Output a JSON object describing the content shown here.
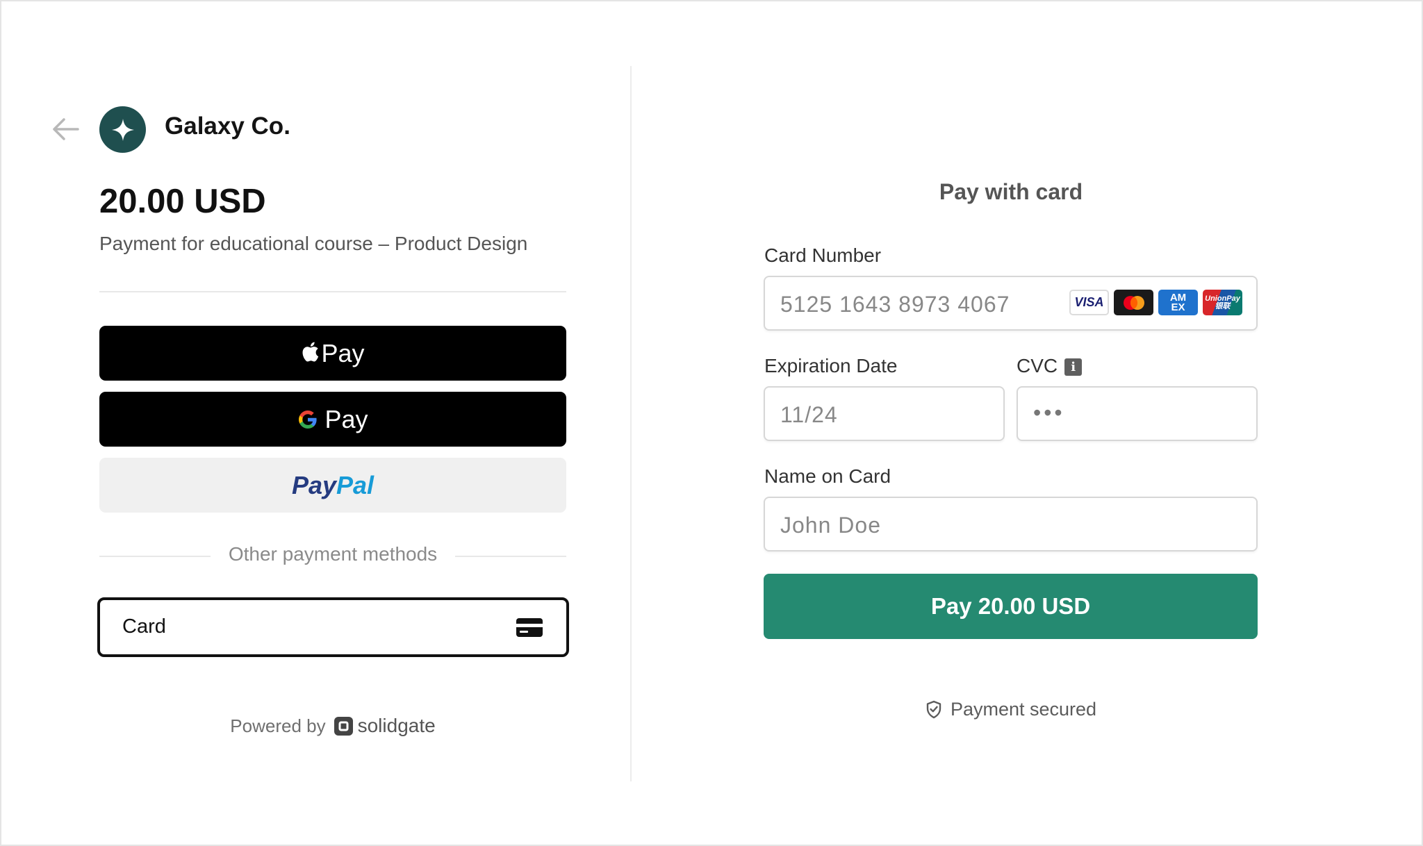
{
  "merchant": {
    "name": "Galaxy Co.",
    "amount": "20.00 USD",
    "description": "Payment for educational course – Product Design"
  },
  "wallets": {
    "apple_pay_label": "Pay",
    "google_pay_label": "Pay",
    "paypal_part1": "Pay",
    "paypal_part2": "Pal"
  },
  "other_methods": {
    "label": "Other payment methods",
    "card_option_label": "Card"
  },
  "footer": {
    "powered_by": "Powered by",
    "provider": "solidgate"
  },
  "card_form": {
    "title": "Pay with card",
    "card_number_label": "Card Number",
    "card_number_value": "5125 1643 8973 4067",
    "card_brands": [
      "visa-icon",
      "mastercard-icon",
      "amex-icon",
      "unionpay-icon"
    ],
    "visa_text": "VISA",
    "amex_text_1": "AM",
    "amex_text_2": "EX",
    "unionpay_text_1": "UnionPay",
    "unionpay_text_2": "银联",
    "expiration_label": "Expiration Date",
    "expiration_value": "11/24",
    "cvc_label": "CVC",
    "cvc_info": "i",
    "cvc_value": "•••",
    "name_label": "Name on Card",
    "name_value": "John Doe",
    "pay_button": "Pay 20.00 USD",
    "secured_text": "Payment secured"
  },
  "colors": {
    "accent": "#258a71",
    "logo_bg": "#1f4f4f",
    "wallet_bg": "#000000",
    "paypal_bg": "#f0f0f0"
  }
}
